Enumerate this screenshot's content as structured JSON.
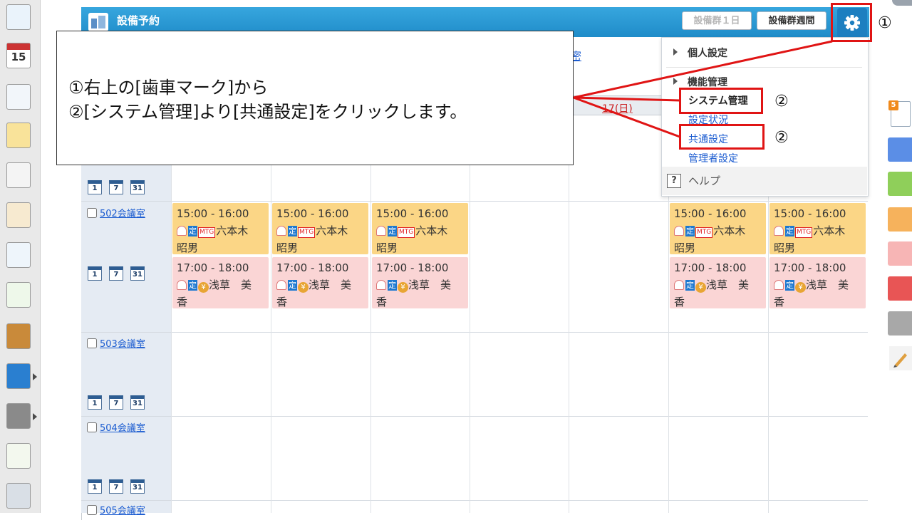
{
  "app": {
    "title": "設備予約",
    "buttons": {
      "day_label": "設備群１日",
      "week_label": "設備群週間"
    },
    "hidden_tab_fragment": "密",
    "date_fragment": "17(日)"
  },
  "menu": {
    "personal_settings": "個人設定",
    "function_management": "機能管理",
    "system_management": "システム管理",
    "settings_status": "設定状況",
    "common_settings": "共通設定",
    "admin_settings": "管理者設定",
    "help_icon_text": "?",
    "help": "ヘルプ"
  },
  "callout": {
    "line1": "①右上の[歯車マーク]から",
    "line2": "②[システム管理]より[共通設定]をクリックします。"
  },
  "markers": {
    "gear_marker": "①",
    "system_marker": "②",
    "common_marker": "②"
  },
  "calendar_icons": [
    "1",
    "7",
    "31"
  ],
  "rooms": [
    {
      "name": "502会議室"
    },
    {
      "name": "503会議室"
    },
    {
      "name": "504会議室"
    },
    {
      "name": "505会議室"
    }
  ],
  "events": {
    "yellow": {
      "time": "15:00 - 16:00",
      "badge_schedule": "定",
      "badge_mtg": "MTG",
      "line1": "六本木",
      "line2": "昭男"
    },
    "pink": {
      "time": "17:00 - 18:00",
      "badge_schedule": "定",
      "coin": "¥",
      "line1": "浅草　美",
      "line2": "香"
    }
  },
  "colors": {
    "title_bar": "#1f8cc9",
    "gear_button": "#1d7fc0",
    "event_yellow": "#fbd686",
    "event_pink": "#fad5d5",
    "highlight_red": "#e01414",
    "link_blue": "#1a5bd0"
  },
  "icons": {
    "gear": "gear-icon",
    "help": "question-icon",
    "user": "user-icon",
    "calendar": "calendar-icon"
  }
}
